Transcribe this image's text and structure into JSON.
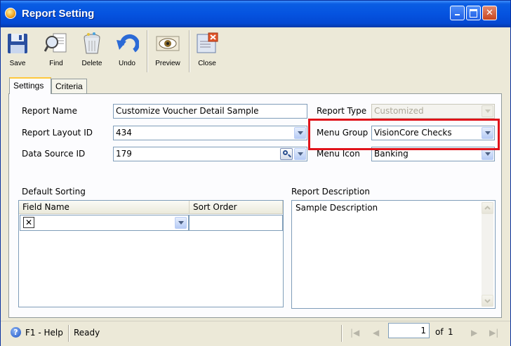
{
  "window": {
    "title": "Report Setting"
  },
  "toolbar": {
    "save": "Save",
    "find": "Find",
    "delete": "Delete",
    "undo": "Undo",
    "preview": "Preview",
    "close": "Close"
  },
  "tabs": {
    "settings": "Settings",
    "criteria": "Criteria"
  },
  "form": {
    "report_name_label": "Report Name",
    "report_name_value": "Customize Voucher Detail Sample",
    "report_type_label": "Report Type",
    "report_type_value": "Customized",
    "layout_label": "Report Layout ID",
    "layout_value": "434",
    "menu_group_label": "Menu Group",
    "menu_group_value": "VisionCore Checks",
    "datasource_label": "Data Source ID",
    "datasource_value": "179",
    "menu_icon_label": "Menu Icon",
    "menu_icon_value": "Banking"
  },
  "sorting": {
    "label": "Default Sorting",
    "col_field": "Field Name",
    "col_order": "Sort Order"
  },
  "description": {
    "label": "Report Description",
    "value": "Sample Description"
  },
  "status": {
    "help": "F1 - Help",
    "state": "Ready",
    "page": "1",
    "of": "of",
    "total": "1"
  }
}
